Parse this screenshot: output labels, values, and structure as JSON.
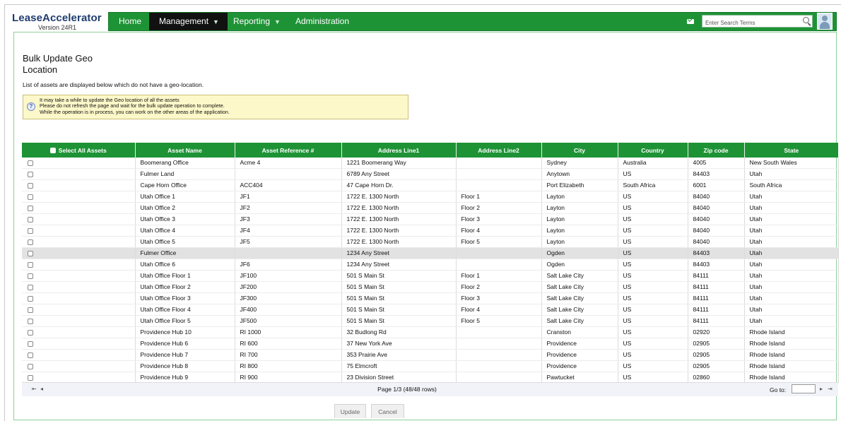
{
  "app": {
    "logo_text": "LeaseAccelerator",
    "version": "Version 24R1"
  },
  "nav": {
    "items": [
      "Home",
      "Management",
      "Reporting",
      "Administration"
    ],
    "active": "Management",
    "caret": "▼"
  },
  "search": {
    "placeholder": "Enter Search Terms"
  },
  "icons": {
    "mail": "mail-icon",
    "search": "search-icon",
    "avatar": "user-avatar-icon",
    "help": "help-icon"
  },
  "page": {
    "title": "Bulk Update Geo Location",
    "description": "List of assets are displayed below which do not have a geo-location.",
    "notice_lines": [
      "It may take a while to update the Geo location of all the assets",
      "Please do not refresh the page and wait for the bulk update operation to complete.",
      "While the operation is in process, you can work on the other areas of the application."
    ]
  },
  "table": {
    "select_all_label": "Select All Assets",
    "columns": [
      "Asset Name",
      "Asset Reference #",
      "Address Line1",
      "Address Line2",
      "City",
      "Country",
      "Zip code",
      "State"
    ],
    "rows": [
      [
        "Boomerang Office",
        "Acme 4",
        "1221 Boomerang Way",
        "",
        "Sydney",
        "Australia",
        "4005",
        "New South Wales"
      ],
      [
        "Fulmer Land",
        "",
        "6789 Any Street",
        "",
        "Anytown",
        "US",
        "84403",
        "Utah"
      ],
      [
        "Cape Horn Office",
        "ACC404",
        "47 Cape Horn Dr.",
        "",
        "Port Elizabeth",
        "South Africa",
        "6001",
        "South Africa"
      ],
      [
        "Utah Office 1",
        "JF1",
        "1722 E. 1300 North",
        "Floor 1",
        "Layton",
        "US",
        "84040",
        "Utah"
      ],
      [
        "Utah Office 2",
        "JF2",
        "1722 E. 1300 North",
        "Floor 2",
        "Layton",
        "US",
        "84040",
        "Utah"
      ],
      [
        "Utah Office 3",
        "JF3",
        "1722 E. 1300 North",
        "Floor 3",
        "Layton",
        "US",
        "84040",
        "Utah"
      ],
      [
        "Utah Office 4",
        "JF4",
        "1722 E. 1300 North",
        "Floor 4",
        "Layton",
        "US",
        "84040",
        "Utah"
      ],
      [
        "Utah Office 5",
        "JF5",
        "1722 E. 1300 North",
        "Floor 5",
        "Layton",
        "US",
        "84040",
        "Utah"
      ],
      [
        "Fulmer Office",
        "",
        "1234 Any Street",
        "",
        "Ogden",
        "US",
        "84403",
        "Utah"
      ],
      [
        "Utah Office 6",
        "JF6",
        "1234 Any Street",
        "",
        "Ogden",
        "US",
        "84403",
        "Utah"
      ],
      [
        "Utah Office Floor 1",
        "JF100",
        "501 S Main St",
        "Floor 1",
        "Salt Lake City",
        "US",
        "84111",
        "Utah"
      ],
      [
        "Utah Office Floor 2",
        "JF200",
        "501 S Main St",
        "Floor 2",
        "Salt Lake City",
        "US",
        "84111",
        "Utah"
      ],
      [
        "Utah Office Floor 3",
        "JF300",
        "501 S Main St",
        "Floor 3",
        "Salt Lake City",
        "US",
        "84111",
        "Utah"
      ],
      [
        "Utah Office Floor 4",
        "JF400",
        "501 S Main St",
        "Floor 4",
        "Salt Lake City",
        "US",
        "84111",
        "Utah"
      ],
      [
        "Utah Office Floor 5",
        "JF500",
        "501 S Main St",
        "Floor 5",
        "Salt Lake City",
        "US",
        "84111",
        "Utah"
      ],
      [
        "Providence Hub 10",
        "RI 1000",
        "32 Budlong Rd",
        "",
        "Cranston",
        "US",
        "02920",
        "Rhode Island"
      ],
      [
        "Providence Hub 6",
        "RI 600",
        "37 New York Ave",
        "",
        "Providence",
        "US",
        "02905",
        "Rhode Island"
      ],
      [
        "Providence Hub 7",
        "RI 700",
        "353 Prairie Ave",
        "",
        "Providence",
        "US",
        "02905",
        "Rhode Island"
      ],
      [
        "Providence Hub 8",
        "RI 800",
        "75 Elmcroft",
        "",
        "Providence",
        "US",
        "02905",
        "Rhode Island"
      ],
      [
        "Providence Hub 9",
        "RI 900",
        "23 Division Street",
        "",
        "Pawtucket",
        "US",
        "02860",
        "Rhode Island"
      ]
    ],
    "highlighted_row": "Fulmer Office"
  },
  "pager": {
    "page_info": "Page 1/3 (48/48 rows)",
    "goto_label": "Go to:",
    "first": "⇤",
    "prev": "◂",
    "next": "▸",
    "last": "⇥"
  },
  "actions": {
    "update_label": "Update",
    "cancel_label": "Cancel"
  },
  "colors": {
    "brand_green": "#1e9336",
    "active_nav": "#111111",
    "notice_bg": "#fdf8c9",
    "highlight_row": "#e2e2e2"
  }
}
